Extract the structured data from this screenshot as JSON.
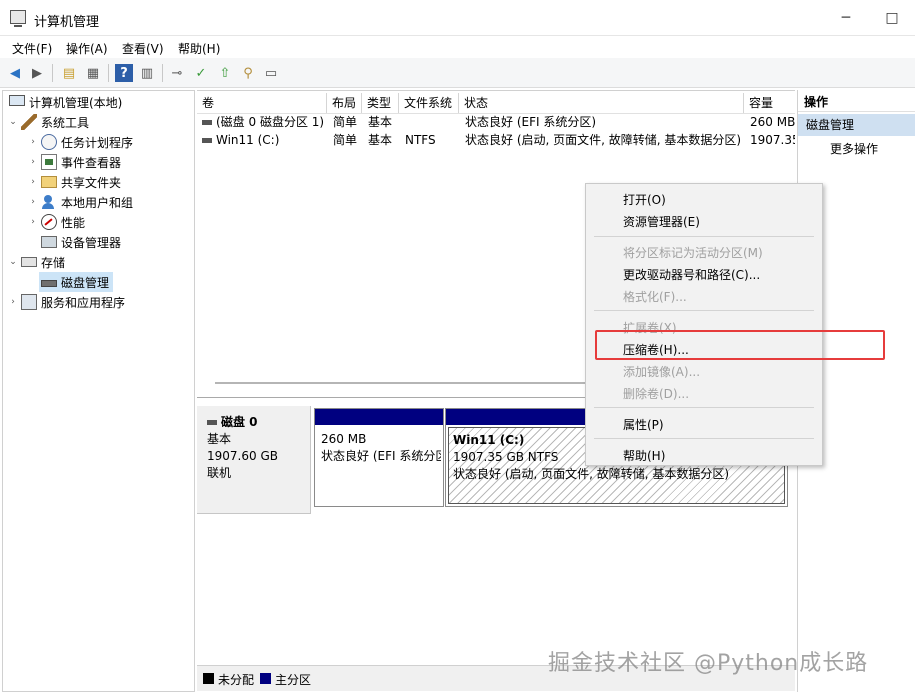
{
  "window": {
    "title": "计算机管理"
  },
  "menubar": [
    {
      "label": "文件(F)"
    },
    {
      "label": "操作(A)"
    },
    {
      "label": "查看(V)"
    },
    {
      "label": "帮助(H)"
    }
  ],
  "toolbar": {
    "icons": [
      "back-icon",
      "forward-icon",
      "up-folder-icon",
      "show-hide-tree-icon",
      "help-icon",
      "properties-icon",
      "connect-icon",
      "check-icon",
      "upload-icon",
      "search-icon",
      "settings-icon"
    ]
  },
  "tree": {
    "root": "计算机管理(本地)",
    "system_tools": "系统工具",
    "task_scheduler": "任务计划程序",
    "event_viewer": "事件查看器",
    "shared_folders": "共享文件夹",
    "local_users": "本地用户和组",
    "performance": "性能",
    "device_manager": "设备管理器",
    "storage": "存储",
    "disk_management": "磁盘管理",
    "services_apps": "服务和应用程序"
  },
  "volume_table": {
    "headers": [
      "卷",
      "布局",
      "类型",
      "文件系统",
      "状态",
      "容量"
    ],
    "rows": [
      {
        "volume": "(磁盘 0 磁盘分区 1)",
        "layout": "简单",
        "type": "基本",
        "fs": "",
        "status": "状态良好 (EFI 系统分区)",
        "capacity": "260 MB"
      },
      {
        "volume": "Win11 (C:)",
        "layout": "简单",
        "type": "基本",
        "fs": "NTFS",
        "status": "状态良好 (启动, 页面文件, 故障转储, 基本数据分区)",
        "capacity": "1907.35"
      }
    ]
  },
  "disk": {
    "name": "磁盘 0",
    "kind": "基本",
    "size": "1907.60 GB",
    "state": "联机",
    "partitions": [
      {
        "size": "260 MB",
        "status": "状态良好 (EFI 系统分区)"
      },
      {
        "label": "Win11  (C:)",
        "size": "1907.35 GB NTFS",
        "status": "状态良好 (启动, 页面文件, 故障转储, 基本数据分区)"
      }
    ]
  },
  "legend": [
    {
      "label": "未分配",
      "color": "#000000"
    },
    {
      "label": "主分区",
      "color": "#000080"
    }
  ],
  "actions": {
    "title": "操作",
    "section": "磁盘管理",
    "more": "更多操作"
  },
  "context_menu": {
    "open": "打开(O)",
    "explorer": "资源管理器(E)",
    "mark_active": "将分区标记为活动分区(M)",
    "change_letter": "更改驱动器号和路径(C)...",
    "format": "格式化(F)...",
    "extend": "扩展卷(X)...",
    "shrink": "压缩卷(H)...",
    "add_mirror": "添加镜像(A)...",
    "delete": "删除卷(D)...",
    "properties": "属性(P)",
    "help": "帮助(H)"
  },
  "watermark": "掘金技术社区 @Python成长路"
}
